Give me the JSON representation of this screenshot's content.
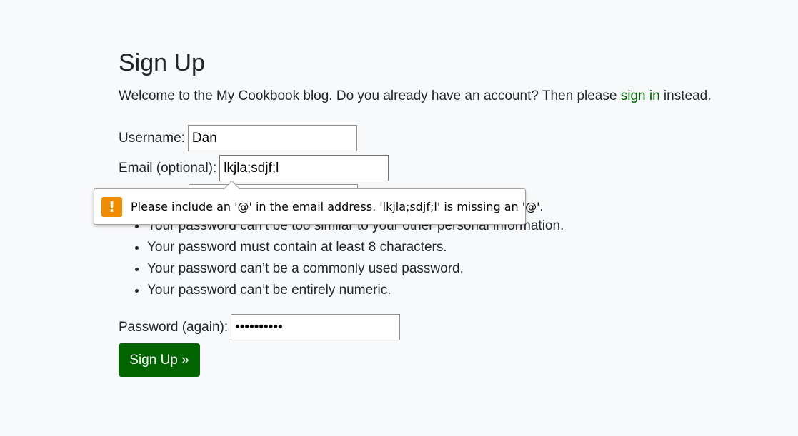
{
  "page": {
    "title": "Sign Up",
    "intro_before": "Welcome to the My Cookbook blog. Do you already have an account? Then please ",
    "intro_link": "sign in",
    "intro_after": " instead."
  },
  "form": {
    "username_label": "Username:",
    "username_value": "Dan",
    "email_label": "Email (optional):",
    "email_value": "lkjla;sdjf;l",
    "password_rules": [
      "Your password can’t be too similar to your other personal information.",
      "Your password must contain at least 8 characters.",
      "Your password can’t be a commonly used password.",
      "Your password can’t be entirely numeric."
    ],
    "password_again_label": "Password (again):",
    "password_again_value": "••••••••••",
    "submit_label": "Sign Up »"
  },
  "tooltip": {
    "icon": "warning-icon",
    "icon_glyph": "!",
    "message": "Please include an '@' in the email address. 'lkjla;sdjf;l' is missing an '@'."
  },
  "colors": {
    "link": "#006400",
    "button_bg": "#006400",
    "warning": "#f08c00",
    "page_bg": "#f8f9fa"
  }
}
